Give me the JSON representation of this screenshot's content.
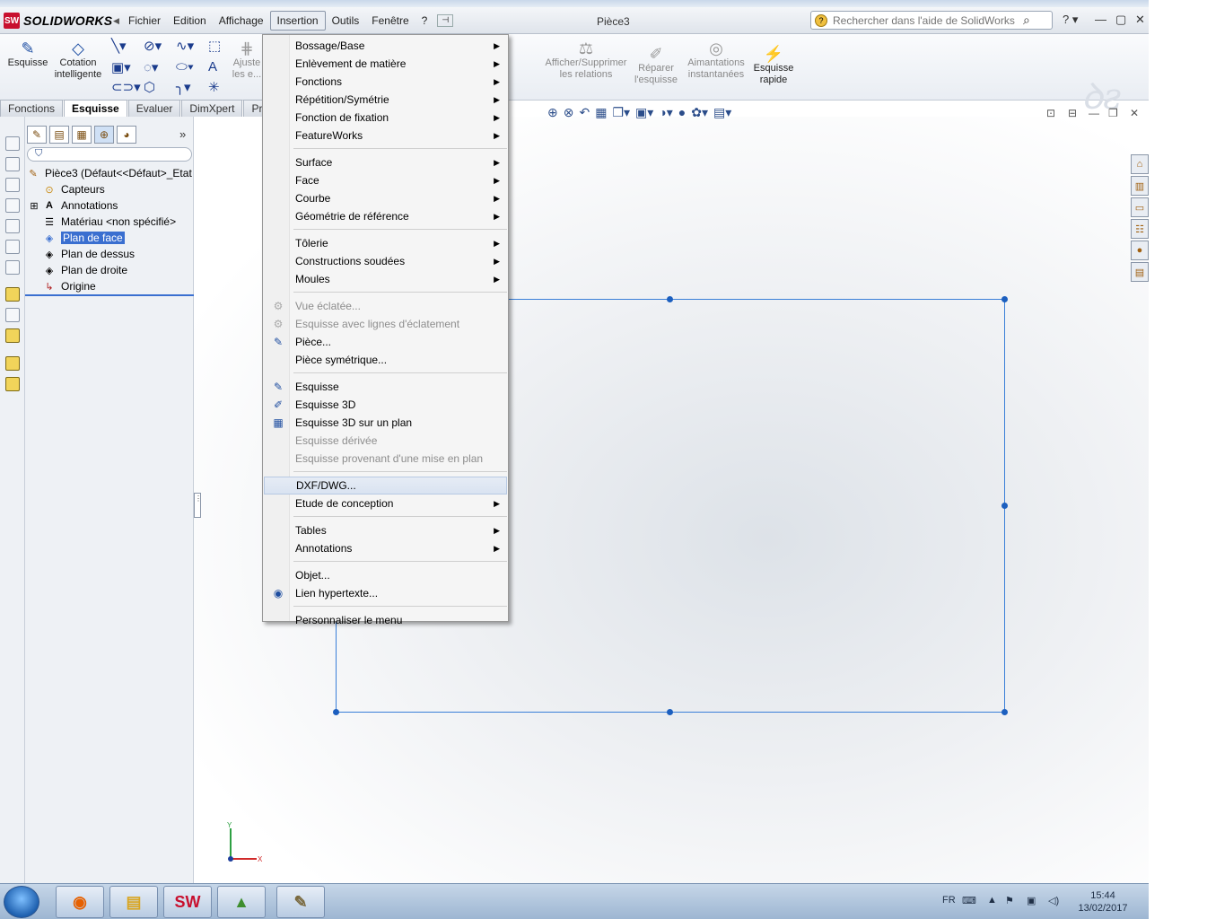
{
  "app": {
    "brand": "SOLIDWORKS",
    "logo_badge": "SW",
    "document_title": "Pièce3"
  },
  "menubar": {
    "items": [
      "Fichier",
      "Edition",
      "Affichage",
      "Insertion",
      "Outils",
      "Fenêtre",
      "?"
    ],
    "active": "Insertion"
  },
  "search": {
    "placeholder": "Rechercher dans l'aide de SolidWorks"
  },
  "ribbon": {
    "esquisse": "Esquisse",
    "cotation_line1": "Cotation",
    "cotation_line2": "intelligente",
    "ajuster_line1": "Ajuste",
    "ajuster_line2": "les e...",
    "afficher_line1": "Afficher/Supprimer",
    "afficher_line2": "les relations",
    "reparer_line1": "Réparer",
    "reparer_line2": "l'esquisse",
    "aimantations_line1": "Aimantations",
    "aimantations_line2": "instantanées",
    "rapide_line1": "Esquisse",
    "rapide_line2": "rapide"
  },
  "tabs": [
    "Fonctions",
    "Esquisse",
    "Evaluer",
    "DimXpert",
    "Proc"
  ],
  "active_tab": "Esquisse",
  "feature_tree": {
    "root": "Pièce3  (Défaut<<Défaut>_Etat",
    "items": [
      {
        "label": "Capteurs",
        "icon": "sensor-icon"
      },
      {
        "label": "Annotations",
        "icon": "annotations-icon"
      },
      {
        "label": "Matériau <non spécifié>",
        "icon": "material-icon"
      },
      {
        "label": "Plan de face",
        "icon": "plane-icon",
        "selected": true
      },
      {
        "label": "Plan de dessus",
        "icon": "plane-icon"
      },
      {
        "label": "Plan de droite",
        "icon": "plane-icon"
      },
      {
        "label": "Origine",
        "icon": "origin-icon"
      }
    ]
  },
  "insertion_menu": {
    "items": [
      {
        "label": "Bossage/Base",
        "submenu": true
      },
      {
        "label": "Enlèvement de matière",
        "submenu": true
      },
      {
        "label": "Fonctions",
        "submenu": true
      },
      {
        "label": "Répétition/Symétrie",
        "submenu": true
      },
      {
        "label": "Fonction de fixation",
        "submenu": true
      },
      {
        "label": "FeatureWorks",
        "submenu": true
      },
      {
        "label": "Surface",
        "submenu": true
      },
      {
        "label": "Face",
        "submenu": true
      },
      {
        "label": "Courbe",
        "submenu": true
      },
      {
        "label": "Géométrie de référence",
        "submenu": true
      },
      {
        "label": "Tôlerie",
        "submenu": true
      },
      {
        "label": "Constructions soudées",
        "submenu": true
      },
      {
        "label": "Moules",
        "submenu": true
      },
      {
        "label": "Vue éclatée...",
        "disabled": true,
        "icon": "exploded-view-icon"
      },
      {
        "label": "Esquisse avec lignes d'éclatement",
        "disabled": true,
        "icon": "explode-line-sketch-icon"
      },
      {
        "label": "Pièce...",
        "icon": "part-icon"
      },
      {
        "label": "Pièce symétrique..."
      },
      {
        "label": "Esquisse",
        "icon": "sketch-icon"
      },
      {
        "label": "Esquisse 3D",
        "icon": "sketch-3d-icon"
      },
      {
        "label": "Esquisse 3D sur un plan",
        "icon": "sketch-3d-plane-icon"
      },
      {
        "label": "Esquisse dérivée",
        "disabled": true
      },
      {
        "label": "Esquisse provenant d'une mise en plan",
        "disabled": true
      },
      {
        "label": "DXF/DWG...",
        "hover": true
      },
      {
        "label": "Etude de conception",
        "submenu": true
      },
      {
        "label": "Tables",
        "submenu": true
      },
      {
        "label": "Annotations",
        "submenu": true
      },
      {
        "label": "Objet..."
      },
      {
        "label": "Lien hypertexte...",
        "icon": "hyperlink-icon"
      },
      {
        "label": "Personnaliser le menu"
      }
    ]
  },
  "triad": {
    "x_label": "X",
    "y_label": "Y"
  },
  "taskbar": {
    "lang": "FR",
    "time": "15:44",
    "date": "13/02/2017"
  },
  "colors": {
    "sketch_line": "#3a7fd8",
    "selection": "#3a6fd0",
    "accent_red": "#c8102e"
  }
}
